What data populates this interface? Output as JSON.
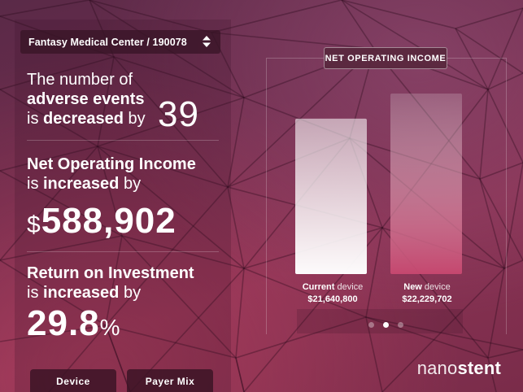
{
  "selector": {
    "value": "Fantasy Medical Center / 190078"
  },
  "adverse": {
    "line1": "The number of",
    "line2_bold": "adverse events",
    "line3_pre": "is ",
    "line3_bold": "decreased",
    "line3_post": " by",
    "value": "39"
  },
  "noi": {
    "line1_bold": "Net Operating Income",
    "line2_pre": "is ",
    "line2_bold": "increased",
    "line2_post": " by",
    "currency": "$",
    "value": "588,902"
  },
  "roi": {
    "line1_bold": "Return on Investment",
    "line2_pre": "is ",
    "line2_bold": "increased",
    "line2_post": " by",
    "value": "29.8",
    "unit": "%"
  },
  "tabs": [
    {
      "label": "Device"
    },
    {
      "label": "Payer Mix"
    }
  ],
  "chart_data": {
    "type": "bar",
    "title": "NET OPERATING INCOME",
    "categories": [
      "Current device",
      "New device"
    ],
    "category_parts": [
      {
        "bold": "Current",
        "light": " device"
      },
      {
        "bold": "New",
        "light": " device"
      }
    ],
    "values": [
      21640800,
      22229702
    ],
    "value_labels": [
      "$21,640,800",
      "$22,229,702"
    ],
    "colors": [
      "#ffffff",
      "#c84870"
    ],
    "ylim": [
      18000000,
      22800000
    ],
    "grid": false,
    "legend": "none"
  },
  "pager": {
    "count": 3,
    "active": 1
  },
  "brand": {
    "light": "nano",
    "bold": "stent"
  }
}
